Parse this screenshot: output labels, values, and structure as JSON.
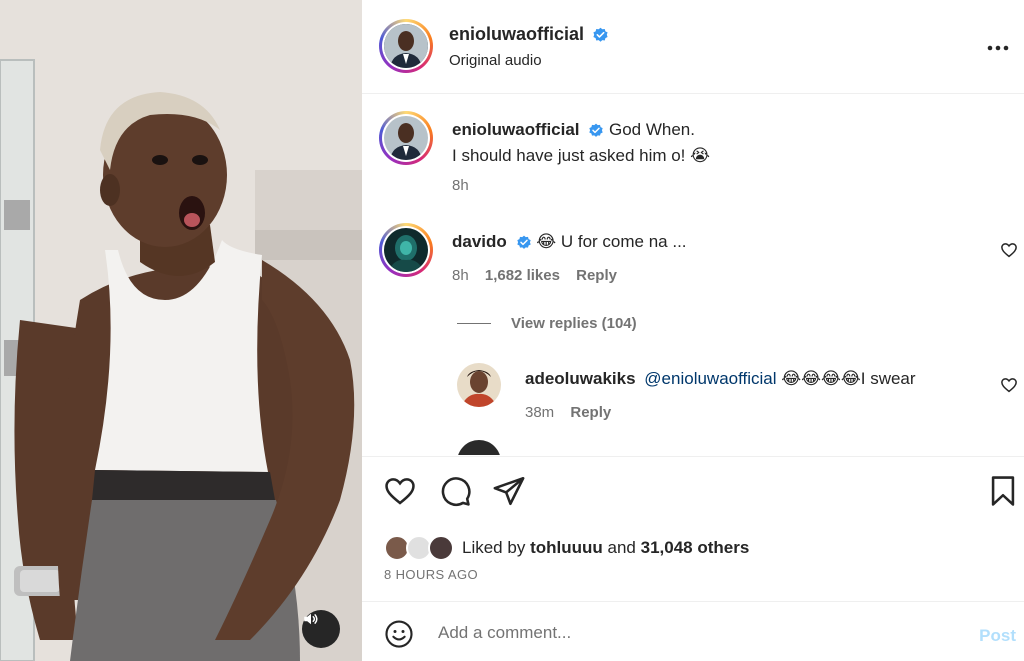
{
  "post": {
    "author": "enioluwaofficial",
    "audio": "Original audio"
  },
  "caption": {
    "author": "enioluwaofficial",
    "line1": "God When.",
    "line2": "I should have just asked him o!",
    "emoji": "😭",
    "time": "8h"
  },
  "comments": [
    {
      "author": "davido",
      "emoji": "😂",
      "text": "U for come na ...",
      "time": "8h",
      "likes": "1,682 likes",
      "reply": "Reply",
      "view_replies": "View replies (104)"
    },
    {
      "author": "adeoluwakiks",
      "mention": "@enioluwaofficial",
      "emojis": "😂😂😂😂",
      "text": "I swear",
      "time": "38m",
      "reply": "Reply"
    }
  ],
  "likes": {
    "prefix": "Liked by",
    "user": "tohluuuu",
    "middle": "and",
    "others": "31,048 others"
  },
  "timestamp": "8 HOURS AGO",
  "add_comment": {
    "placeholder": "Add a comment...",
    "post_label": "Post"
  },
  "colors": {
    "verified": "#3897f0",
    "mention": "#00376b",
    "post_disabled": "#b2dffc",
    "meta": "#737373"
  }
}
